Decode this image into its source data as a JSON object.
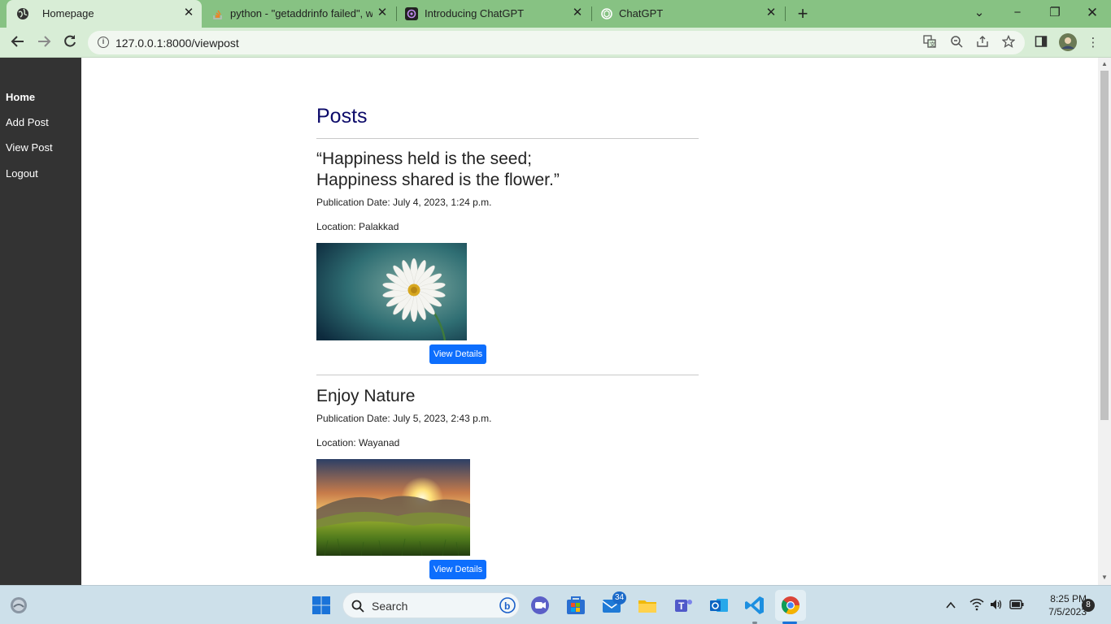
{
  "browser": {
    "tabs": [
      {
        "title": "Homepage",
        "active": true,
        "favicon": "globe-icon"
      },
      {
        "title": "python - \"getaddrinfo failed\", wh",
        "active": false,
        "favicon": "stackoverflow-icon"
      },
      {
        "title": "Introducing ChatGPT",
        "active": false,
        "favicon": "openai-icon"
      },
      {
        "title": "ChatGPT",
        "active": false,
        "favicon": "chatgpt-icon"
      }
    ],
    "url": "127.0.0.1:8000/viewpost",
    "accent": "#87c283"
  },
  "sidebar": {
    "items": [
      {
        "label": "Home",
        "bold": true
      },
      {
        "label": "Add Post"
      },
      {
        "label": "View Post"
      },
      {
        "label": "Logout"
      }
    ]
  },
  "main": {
    "title": "Posts",
    "posts": [
      {
        "title_line1": "“Happiness held is the seed;",
        "title_line2": "Happiness shared is the flower.”",
        "date": "Publication Date: July 4, 2023, 1:24 p.m.",
        "location": "Location: Palakkad",
        "button": "View Details",
        "image": "daisy-flower-photo"
      },
      {
        "title_line1": "Enjoy Nature",
        "date": "Publication Date: July 5, 2023, 2:43 p.m.",
        "location": "Location: Wayanad",
        "button": "View Details",
        "image": "sunset-hills-photo"
      }
    ]
  },
  "taskbar": {
    "search_label": "Search",
    "mail_badge": "34",
    "notification_badge": "8",
    "time": "8:25 PM",
    "date": "7/5/2023"
  }
}
